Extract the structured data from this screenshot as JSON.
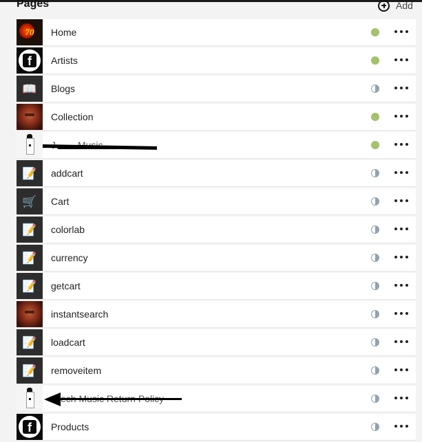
{
  "header": {
    "title": "Pages",
    "add_label": "Add"
  },
  "colors": {
    "published": "#a3c26b",
    "partial": "#8fa3b3",
    "row_background": "#ffffff",
    "page_background": "#f3f3f3"
  },
  "pages": [
    {
      "label": "Home",
      "thumb": "brand-logo",
      "status": "published"
    },
    {
      "label": "Artists",
      "thumb": "facebook-logo",
      "status": "published"
    },
    {
      "label": "Blogs",
      "thumb": "book-icon",
      "status": "published-partial"
    },
    {
      "label": "Collection",
      "thumb": "portrait-photo",
      "status": "published"
    },
    {
      "label": "J… …Music",
      "thumb": "figure-photo",
      "status": "published",
      "redacted": true
    },
    {
      "label": "addcart",
      "thumb": "memo-icon",
      "status": "partial"
    },
    {
      "label": "Cart",
      "thumb": "shopping-cart-icon",
      "status": "partial"
    },
    {
      "label": "colorlab",
      "thumb": "memo-icon",
      "status": "partial"
    },
    {
      "label": "currency",
      "thumb": "memo-icon",
      "status": "partial"
    },
    {
      "label": "getcart",
      "thumb": "memo-icon",
      "status": "partial"
    },
    {
      "label": "instantsearch",
      "thumb": "portrait-photo",
      "status": "partial"
    },
    {
      "label": "loadcart",
      "thumb": "memo-icon",
      "status": "partial"
    },
    {
      "label": "removeitem",
      "thumb": "memo-icon",
      "status": "partial"
    },
    {
      "label": "…ech Music Return Policy",
      "thumb": "figure-photo",
      "status": "partial",
      "redacted": true
    },
    {
      "label": "Products",
      "thumb": "facebook-logo",
      "status": "partial"
    }
  ]
}
